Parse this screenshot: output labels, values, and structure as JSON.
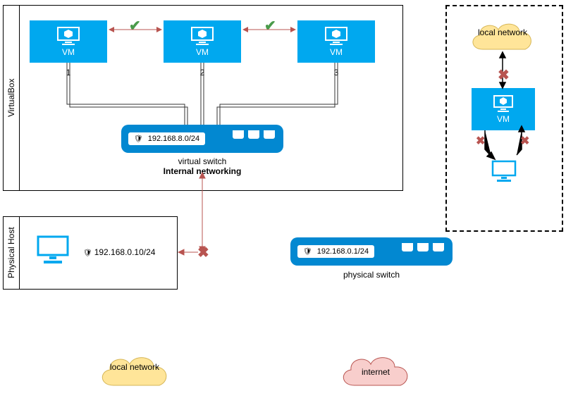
{
  "sections": {
    "virtualbox": "VirtualBox",
    "physicalhost": "Physical Host"
  },
  "vms": [
    {
      "label": "VM",
      "num": "1"
    },
    {
      "label": "VM",
      "num": "2"
    },
    {
      "label": "VM",
      "num": "3"
    }
  ],
  "virtual_switch": {
    "ip": "192.168.8.0/24",
    "label": "virtual switch",
    "sublabel": "Internal networking"
  },
  "physical_host": {
    "ip": "192.168.0.10/24"
  },
  "physical_switch": {
    "ip": "192.168.0.1/24",
    "label": "physical switch"
  },
  "clouds": {
    "local": "local network",
    "internet": "internet",
    "local2": "local network"
  },
  "inset": {
    "vm": "VM"
  }
}
